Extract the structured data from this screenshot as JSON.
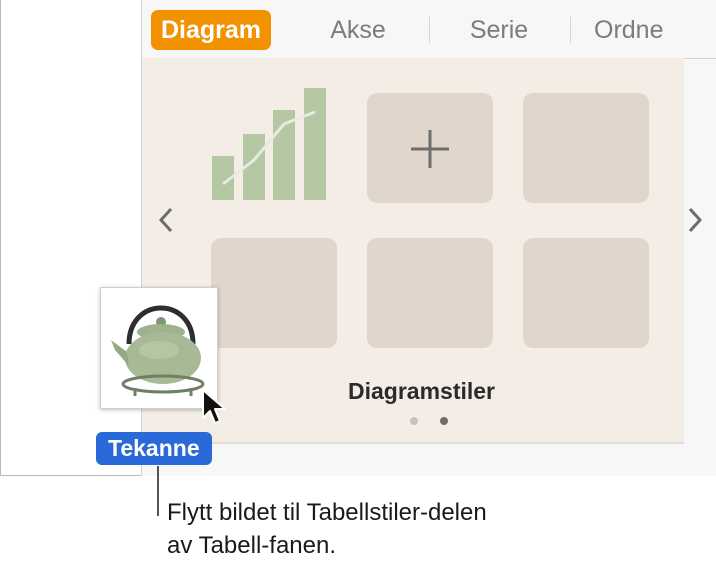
{
  "tabs": [
    {
      "label": "Diagram",
      "active": true
    },
    {
      "label": "Akse",
      "active": false
    },
    {
      "label": "Serie",
      "active": false
    },
    {
      "label": "Ordne",
      "active": false
    }
  ],
  "chart_styles": {
    "label": "Diagramstiler",
    "add_icon": "plus-icon",
    "prev_icon": "chevron-left-icon",
    "next_icon": "chevron-right-icon",
    "page_count": 2,
    "current_page": 2
  },
  "dragged_image": {
    "name": "Tekanne",
    "icon": "teapot-image"
  },
  "cursor_icon": "arrow-cursor-icon",
  "callout": {
    "lines": [
      "Flytt bildet til Tabellstiler-delen",
      "av Tabell-fanen."
    ]
  },
  "colors": {
    "accent_tab": "#f29200",
    "badge": "#2a6ad8",
    "panel": "#f4ede6",
    "swatch": "#e0d6cc",
    "chart_green": "#b5c7a3"
  }
}
